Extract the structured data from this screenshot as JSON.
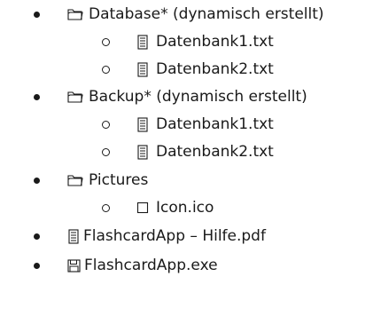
{
  "items": [
    {
      "level": 1,
      "icon": "folder-icon",
      "label": "Database* (dynamisch erstellt)"
    },
    {
      "level": 2,
      "icon": "text-file-icon",
      "label": "Datenbank1.txt"
    },
    {
      "level": 2,
      "icon": "text-file-icon",
      "label": "Datenbank2.txt"
    },
    {
      "level": 1,
      "icon": "folder-icon",
      "label": "Backup* (dynamisch erstellt)"
    },
    {
      "level": 2,
      "icon": "text-file-icon",
      "label": "Datenbank1.txt"
    },
    {
      "level": 2,
      "icon": "text-file-icon",
      "label": "Datenbank2.txt"
    },
    {
      "level": 1,
      "icon": "folder-icon",
      "label": "Pictures"
    },
    {
      "level": 2,
      "icon": "empty-square-icon",
      "label": "Icon.ico"
    },
    {
      "level": 1,
      "icon": "text-file-icon",
      "label": "FlashcardApp – Hilfe.pdf"
    },
    {
      "level": 1,
      "icon": "floppy-disk-icon",
      "label": "FlashcardApp.exe"
    }
  ]
}
